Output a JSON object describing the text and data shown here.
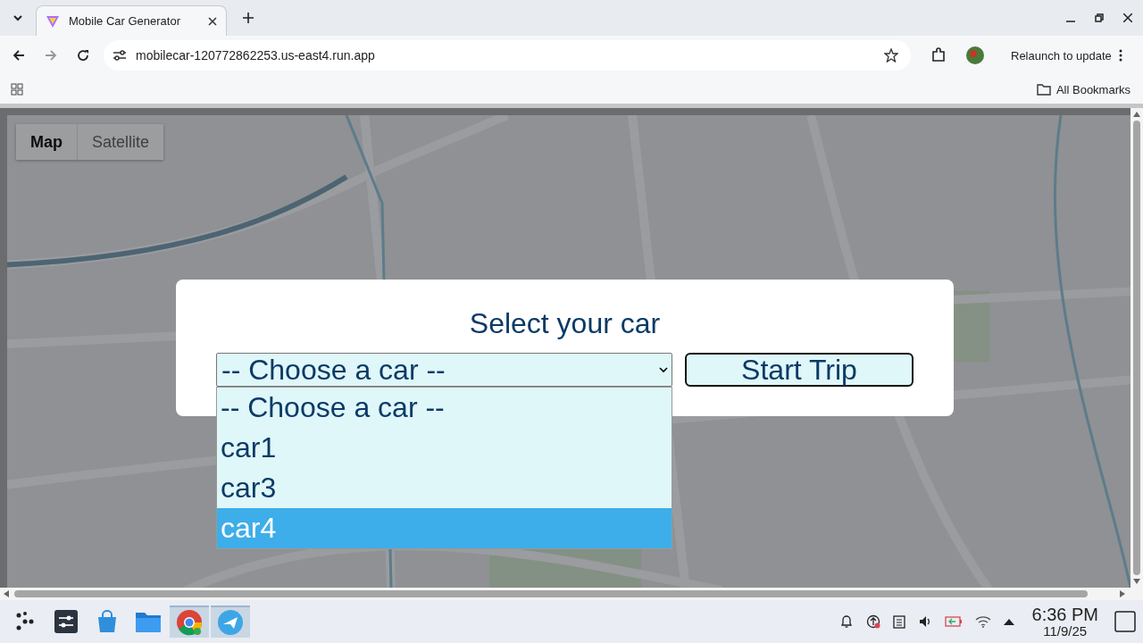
{
  "browser": {
    "tabs": [
      {
        "title": "Mobile Car Generator",
        "selected": true
      }
    ],
    "address": "mobilecar-120772862253.us-east4.run.app",
    "relaunch": "Relaunch to update",
    "bookmarks": "All Bookmarks"
  },
  "map": {
    "kind": "picture",
    "controls": [
      {
        "label": "Map",
        "selected": true
      },
      {
        "label": "Satellite",
        "selected": false
      }
    ]
  },
  "dialog": {
    "title": "Select your car",
    "select_value": "-- Choose a car --",
    "button": "Start Trip",
    "options": [
      {
        "label": "-- Choose a car --",
        "selected": false
      },
      {
        "label": "car1",
        "selected": false
      },
      {
        "label": "car3",
        "selected": false
      },
      {
        "label": "car4",
        "selected": true
      }
    ]
  },
  "taskbar": {
    "apps": [
      {
        "kind": "launcher",
        "active": false
      },
      {
        "kind": "settings",
        "active": false
      },
      {
        "kind": "store",
        "active": false
      },
      {
        "kind": "files",
        "active": false
      },
      {
        "kind": "chrome",
        "active": true
      },
      {
        "kind": "app",
        "active": true
      }
    ],
    "time": "6:36 PM",
    "date": "11/9/25"
  }
}
